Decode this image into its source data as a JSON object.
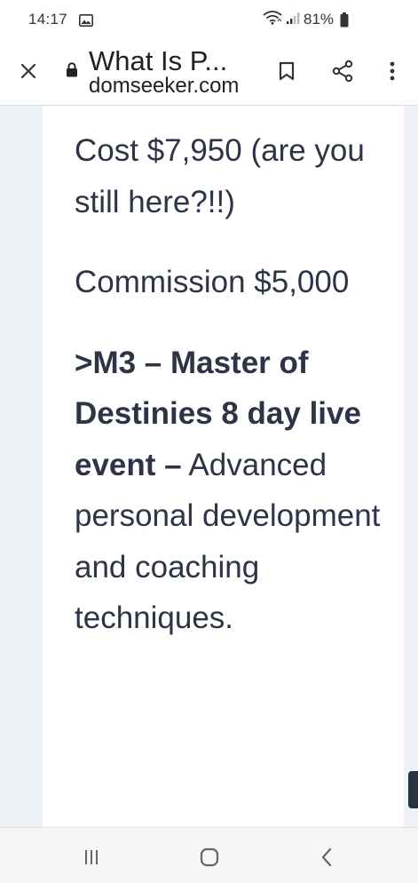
{
  "status_bar": {
    "time": "14:17",
    "battery": "81%"
  },
  "toolbar": {
    "title": "What Is P...",
    "url": "domseeker.com"
  },
  "article": {
    "p1": "Cost $7,950 (are you still here?!!)",
    "p2": "Commission $5,000",
    "p3_bold": ">M3 – Master of Destinies 8 day live event –",
    "p3_text": "Advanced personal development and coaching techniques."
  },
  "colors": {
    "text": "#2d3447",
    "page_margin": "#eef2f6",
    "divider": "#d7dde6"
  },
  "icons": {
    "status": [
      "gallery-icon",
      "wifi-icon",
      "signal-icon",
      "battery-icon"
    ],
    "toolbar": [
      "close-icon",
      "lock-icon",
      "bookmark-icon",
      "share-icon",
      "more-vert-icon"
    ],
    "nav": [
      "recents-icon",
      "home-icon",
      "back-icon"
    ]
  }
}
